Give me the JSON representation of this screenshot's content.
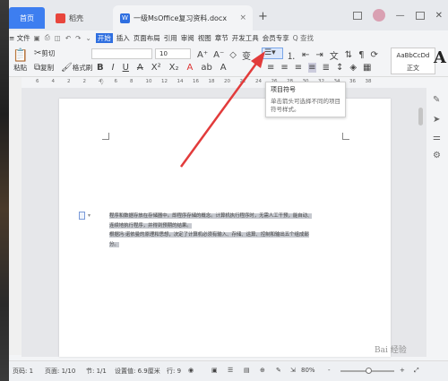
{
  "tabs": {
    "home": "首页",
    "dao": "稻壳",
    "doc": "一级MsOffice复习资料.docx",
    "doc_icon_letter": "W",
    "close_glyph": "×",
    "add_glyph": "+"
  },
  "menu": {
    "file": "≡ 文件",
    "items": [
      "开始",
      "插入",
      "页面布局",
      "引用",
      "审阅",
      "视图",
      "章节",
      "开发工具",
      "会员专享"
    ],
    "active": "开始",
    "search": "Q 查找"
  },
  "ribbon": {
    "paste": "粘贴",
    "cut": "剪切",
    "copy": "复制",
    "format_painter": "格式刷",
    "font_size": "10",
    "style_sample": "AaBbCcDd",
    "style_normal": "正文",
    "big_A": "A"
  },
  "ruler": {
    "ticks": [
      "6",
      "4",
      "2",
      "2",
      "4",
      "6",
      "8",
      "10",
      "12",
      "14",
      "16",
      "18",
      "20",
      "22",
      "24",
      "26",
      "28",
      "30",
      "32",
      "34",
      "36",
      "38"
    ]
  },
  "tooltip": {
    "title": "项目符号",
    "desc": "单击箭头可选择不同的项目符号样式。"
  },
  "document": {
    "lines": [
      "程序和数据存放在存储器中。即程序存储的概念。计算机执行程序时，无需人工干预，能自动、",
      "连续地执行程序，并得到预期的结果。",
      "根据冯·诺依曼的原理和思想，决定了计算机必须有输入、存储、运算、控制和输出五个组成部",
      "分。"
    ]
  },
  "status": {
    "page_num": "页码: 1",
    "page": "页面: 1/10",
    "section": "节: 1/1",
    "position": "设置值: 6.9厘米",
    "row": "行: 9",
    "zoom": "80%",
    "zoom_minus": "-",
    "zoom_plus": "+"
  },
  "watermark": "Bai 经验",
  "colors": {
    "accent": "#2f6fe0",
    "arrow": "#e23b3b",
    "selection": "#c6c9cf"
  }
}
